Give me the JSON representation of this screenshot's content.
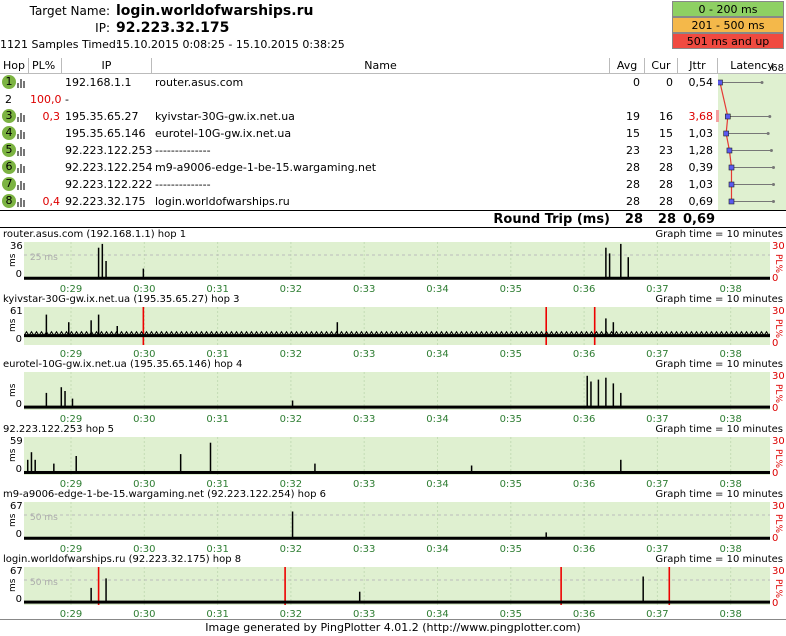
{
  "header": {
    "target_label": "Target Name:",
    "target_value": "login.worldofwarships.ru",
    "ip_label": "IP:",
    "ip_value": "92.223.32.175",
    "samples_label": "1121 Samples Timed:",
    "samples_value": "15.10.2015 0:08:25 - 15.10.2015 0:38:25"
  },
  "legend": [
    {
      "label": "0 - 200 ms",
      "color": "#8ed063"
    },
    {
      "label": "201 - 500 ms",
      "color": "#f4b84a"
    },
    {
      "label": "501 ms and up",
      "color": "#f04a40"
    }
  ],
  "columns": {
    "hop": "Hop",
    "pl": "PL%",
    "ip": "IP",
    "name": "Name",
    "avg": "Avg",
    "cur": "Cur",
    "jttr": "Jttr",
    "latency": "Latency",
    "latency_max": "68"
  },
  "hops": [
    {
      "hop": "1",
      "badge": true,
      "pl": "",
      "ip": "192.168.1.1",
      "name": "router.asus.com",
      "avg": "0",
      "cur": "0",
      "jttr": "0,54",
      "jttr_red": false,
      "lat": 0
    },
    {
      "hop": "2",
      "badge": false,
      "pl": "100,0",
      "ip": "-",
      "name": "",
      "avg": "",
      "cur": "",
      "jttr": "",
      "jttr_red": false,
      "lat": null
    },
    {
      "hop": "3",
      "badge": true,
      "pl": "0,3",
      "ip": "195.35.65.27",
      "name": "kyivstar-30G-gw.ix.net.ua",
      "avg": "19",
      "cur": "16",
      "jttr": "3,68",
      "jttr_red": true,
      "lat": 19
    },
    {
      "hop": "4",
      "badge": true,
      "pl": "",
      "ip": "195.35.65.146",
      "name": "eurotel-10G-gw.ix.net.ua",
      "avg": "15",
      "cur": "15",
      "jttr": "1,03",
      "jttr_red": false,
      "lat": 15
    },
    {
      "hop": "5",
      "badge": true,
      "pl": "",
      "ip": "92.223.122.253",
      "name": "--------------",
      "avg": "23",
      "cur": "23",
      "jttr": "1,28",
      "jttr_red": false,
      "lat": 23
    },
    {
      "hop": "6",
      "badge": true,
      "pl": "",
      "ip": "92.223.122.254",
      "name": "m9-a9006-edge-1-be-15.wargaming.net",
      "avg": "28",
      "cur": "28",
      "jttr": "0,39",
      "jttr_red": false,
      "lat": 28
    },
    {
      "hop": "7",
      "badge": true,
      "pl": "",
      "ip": "92.223.122.222",
      "name": "--------------",
      "avg": "28",
      "cur": "28",
      "jttr": "1,03",
      "jttr_red": false,
      "lat": 28
    },
    {
      "hop": "8",
      "badge": true,
      "pl": "0,4",
      "ip": "92.223.32.175",
      "name": "login.worldofwarships.ru",
      "avg": "28",
      "cur": "28",
      "jttr": "0,69",
      "jttr_red": false,
      "lat": 28
    }
  ],
  "round_trip": {
    "label": "Round Trip (ms)",
    "avg": "28",
    "cur": "28",
    "jttr": "0,69"
  },
  "graph_time": "Graph time = 10 minutes",
  "tick_labels": [
    "0:29",
    "0:30",
    "0:31",
    "0:32",
    "0:33",
    "0:34",
    "0:35",
    "0:36",
    "0:37",
    "0:38"
  ],
  "pl_axis": {
    "top": "30",
    "bottom": "0",
    "unit": "PL%"
  },
  "ms_unit": "ms",
  "graphs": [
    {
      "title": "router.asus.com (192.168.1.1) hop 1",
      "ymax": "36",
      "ref": "25 ms",
      "base": 0.02,
      "spikes": [
        [
          0.1,
          0.85
        ],
        [
          0.105,
          0.95
        ],
        [
          0.11,
          0.5
        ],
        [
          0.16,
          0.3
        ],
        [
          0.78,
          0.85
        ],
        [
          0.785,
          0.7
        ],
        [
          0.8,
          0.95
        ],
        [
          0.81,
          0.6
        ]
      ],
      "red": []
    },
    {
      "title": "kyivstar-30G-gw.ix.net.ua (195.35.65.27) hop 3",
      "ymax": "61",
      "ref": "",
      "base": 0.22,
      "spikes": [
        [
          0.03,
          0.8
        ],
        [
          0.06,
          0.6
        ],
        [
          0.09,
          0.65
        ],
        [
          0.1,
          0.8
        ],
        [
          0.125,
          0.5
        ],
        [
          0.42,
          0.6
        ],
        [
          0.78,
          0.7
        ],
        [
          0.79,
          0.6
        ]
      ],
      "red": [
        0.16,
        0.7,
        0.765
      ]
    },
    {
      "title": "eurotel-10G-gw.ix.net.ua (195.35.65.146) hop 4",
      "ymax": "",
      "ref": "",
      "base": 0.05,
      "spikes": [
        [
          0.03,
          0.45
        ],
        [
          0.05,
          0.6
        ],
        [
          0.055,
          0.5
        ],
        [
          0.065,
          0.3
        ],
        [
          0.36,
          0.25
        ],
        [
          0.755,
          0.9
        ],
        [
          0.76,
          0.75
        ],
        [
          0.77,
          0.8
        ],
        [
          0.78,
          0.85
        ],
        [
          0.79,
          0.7
        ],
        [
          0.8,
          0.45
        ]
      ],
      "red": []
    },
    {
      "title": "92.223.122.253 hop 5",
      "ymax": "59",
      "ref": "",
      "base": 0.04,
      "spikes": [
        [
          0.005,
          0.4
        ],
        [
          0.01,
          0.6
        ],
        [
          0.015,
          0.4
        ],
        [
          0.04,
          0.3
        ],
        [
          0.07,
          0.5
        ],
        [
          0.21,
          0.55
        ],
        [
          0.25,
          0.85
        ],
        [
          0.39,
          0.3
        ],
        [
          0.6,
          0.25
        ],
        [
          0.8,
          0.4
        ]
      ],
      "red": []
    },
    {
      "title": "m9-a9006-edge-1-be-15.wargaming.net (92.223.122.254) hop 6",
      "ymax": "67",
      "ref": "50 ms",
      "base": 0.02,
      "spikes": [
        [
          0.36,
          0.75
        ],
        [
          0.7,
          0.2
        ]
      ],
      "red": []
    },
    {
      "title": "login.worldofwarships.ru (92.223.32.175) hop 8",
      "ymax": "67",
      "ref": "50 ms",
      "base": 0.05,
      "spikes": [
        [
          0.09,
          0.45
        ],
        [
          0.11,
          0.7
        ],
        [
          0.45,
          0.35
        ],
        [
          0.83,
          0.75
        ]
      ],
      "red": [
        0.1,
        0.35,
        0.72,
        0.865
      ]
    }
  ],
  "footer": "Image generated by PingPlotter 4.01.2 (http://www.pingplotter.com)"
}
